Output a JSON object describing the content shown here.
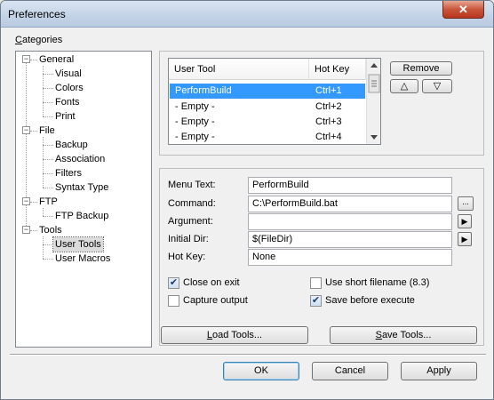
{
  "window": {
    "title": "Preferences",
    "close_glyph": "✕"
  },
  "categories": {
    "label_u": "C",
    "label_rest": "ategories",
    "tree": [
      {
        "label": "General",
        "expander": "−",
        "children": [
          "Visual",
          "Colors",
          "Fonts",
          "Print"
        ]
      },
      {
        "label": "File",
        "expander": "−",
        "children": [
          "Backup",
          "Association",
          "Filters",
          "Syntax Type"
        ]
      },
      {
        "label": "FTP",
        "expander": "−",
        "children": [
          "FTP Backup"
        ]
      },
      {
        "label": "Tools",
        "expander": "−",
        "children": [
          "User Tools",
          "User Macros"
        ]
      }
    ],
    "selected": "User Tools"
  },
  "tool_list": {
    "columns": [
      "User Tool",
      "Hot Key"
    ],
    "rows": [
      {
        "tool": "PerformBuild",
        "hotkey": "Ctrl+1",
        "selected": true
      },
      {
        "tool": "- Empty -",
        "hotkey": "Ctrl+2",
        "selected": false
      },
      {
        "tool": "- Empty -",
        "hotkey": "Ctrl+3",
        "selected": false
      },
      {
        "tool": "- Empty -",
        "hotkey": "Ctrl+4",
        "selected": false
      }
    ]
  },
  "list_buttons": {
    "remove": "Remove",
    "up": "△",
    "down": "▽"
  },
  "form": {
    "menu_text_label": "Menu Text:",
    "menu_text_value": "PerformBuild",
    "command_label": "Command:",
    "command_value": "C:\\PerformBuild.bat",
    "browse_label": "...",
    "argument_label": "Argument:",
    "argument_value": "",
    "initial_dir_label": "Initial Dir:",
    "initial_dir_value": "$(FileDir)",
    "hot_key_label": "Hot Key:",
    "hot_key_value": "None",
    "arrow_glyph": "▶"
  },
  "options": {
    "close_on_exit": {
      "label": "Close on exit",
      "checked": true
    },
    "use_short_filename": {
      "label": "Use short filename (8.3)",
      "checked": false
    },
    "capture_output": {
      "label": "Capture output",
      "checked": false
    },
    "save_before_execute": {
      "label": "Save before execute",
      "checked": true
    },
    "check_glyph": "✔"
  },
  "tools_buttons": {
    "load_u": "L",
    "load_rest": "oad Tools...",
    "save_u": "S",
    "save_rest": "ave Tools..."
  },
  "dialog_buttons": {
    "ok": "OK",
    "cancel": "Cancel",
    "apply": "Apply"
  }
}
